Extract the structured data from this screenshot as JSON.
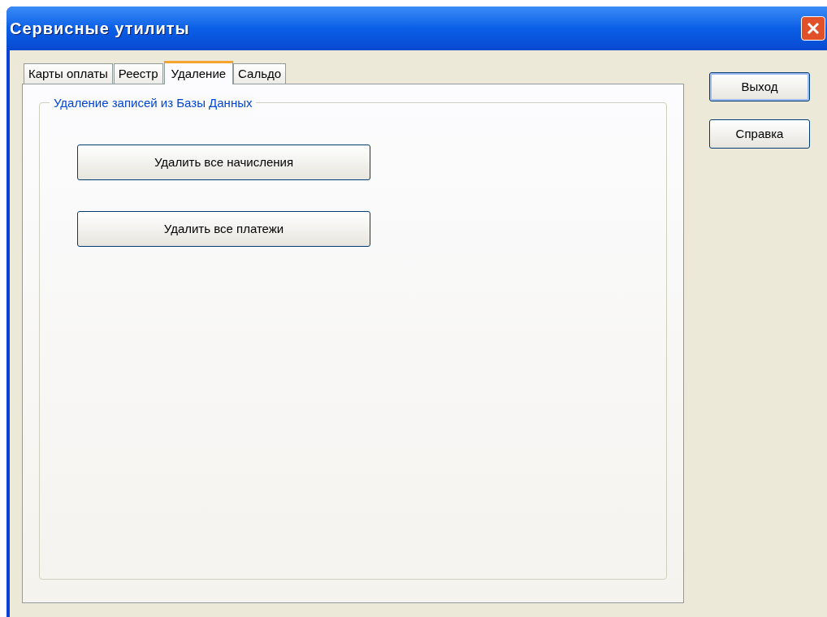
{
  "window": {
    "title": "Сервисные утилиты"
  },
  "tabs": [
    {
      "label": "Карты оплаты",
      "selected": false
    },
    {
      "label": "Реестр",
      "selected": false
    },
    {
      "label": "Удаление",
      "selected": true
    },
    {
      "label": "Сальдо",
      "selected": false
    }
  ],
  "group": {
    "title": "Удаление записей из Базы Данных",
    "buttons": [
      {
        "label": "Удалить все начисления"
      },
      {
        "label": "Удалить все платежи"
      }
    ]
  },
  "side_buttons": [
    {
      "label": "Выход",
      "default": true
    },
    {
      "label": "Справка",
      "default": false
    }
  ]
}
